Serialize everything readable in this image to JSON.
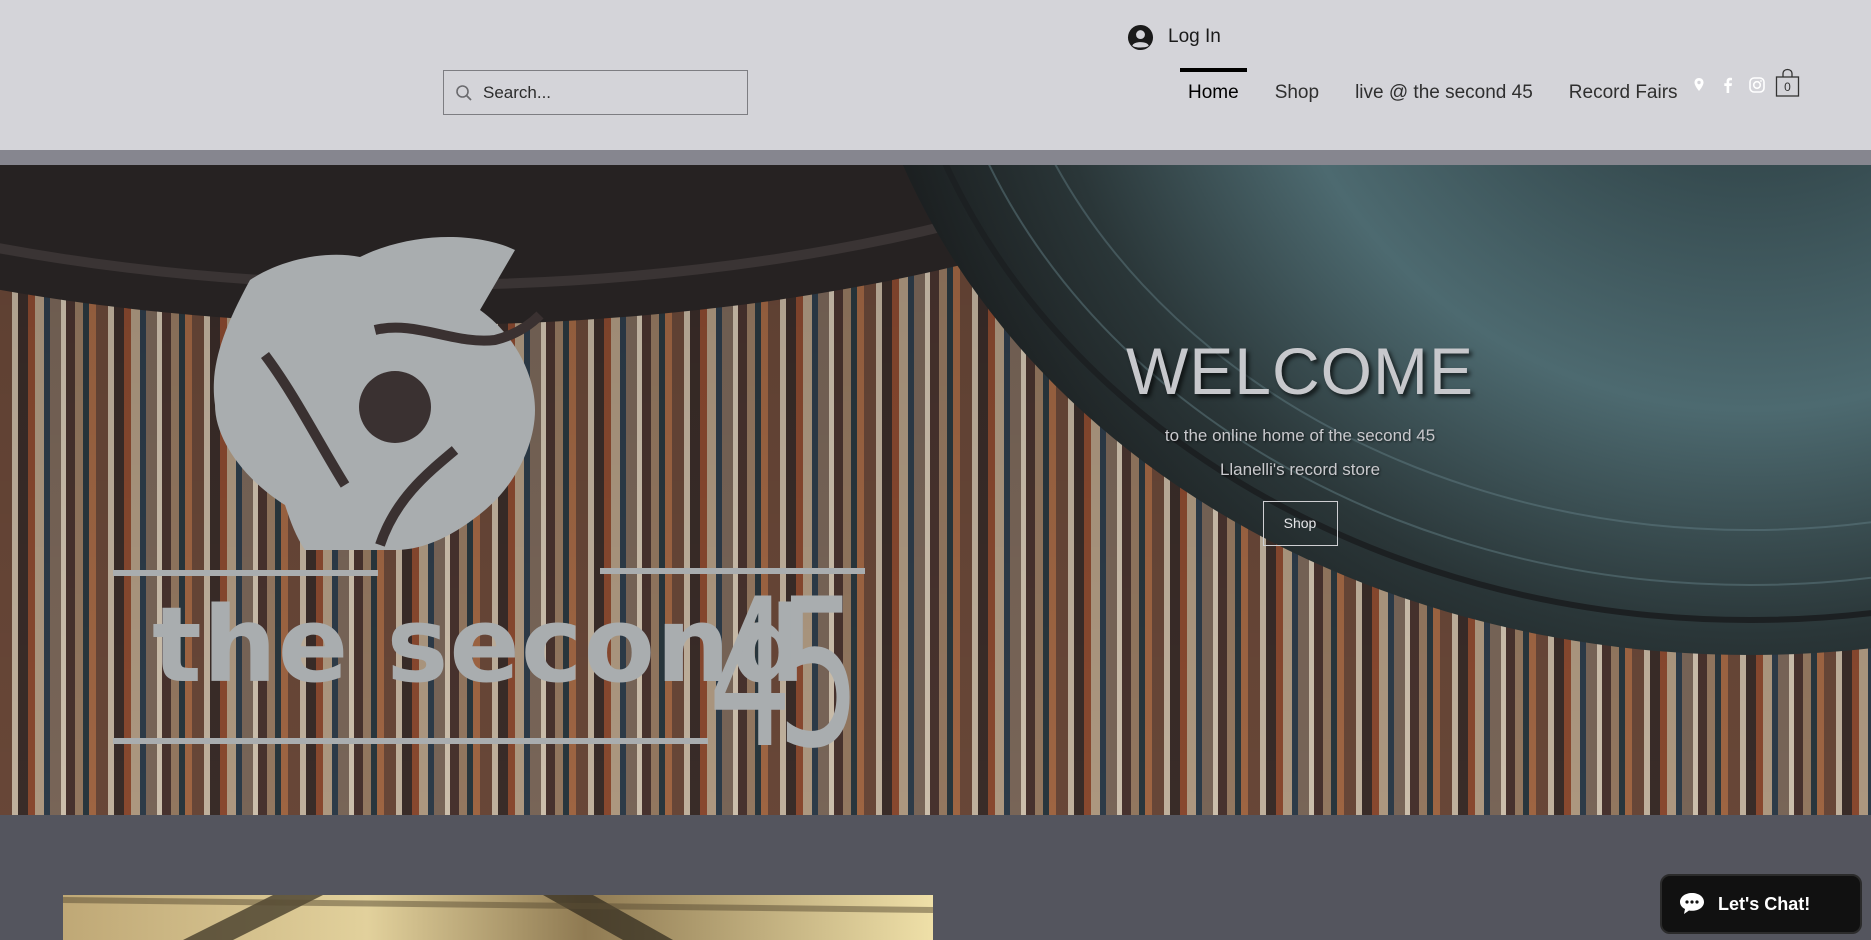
{
  "header": {
    "login_label": "Log In",
    "search_placeholder": "Search...",
    "nav": [
      {
        "label": "Home",
        "active": true
      },
      {
        "label": "Shop"
      },
      {
        "label": "live @ the second 45"
      },
      {
        "label": "Record Fairs"
      }
    ],
    "social_icons": [
      "map-pin-icon",
      "facebook-icon",
      "instagram-icon"
    ],
    "cart_count": "0"
  },
  "hero": {
    "title": "WELCOME",
    "line1": "to the online home of the second 45",
    "line2": "Llanelli's record store",
    "shop_label": "Shop",
    "logo_text": "the second",
    "logo_number": "45"
  },
  "chat": {
    "label": "Let's Chat!"
  },
  "colors": {
    "header_bg": "#d4d4d9",
    "lower_bg": "#54555e",
    "logo_gray": "#a9adaf",
    "chat_bg": "#111111"
  }
}
